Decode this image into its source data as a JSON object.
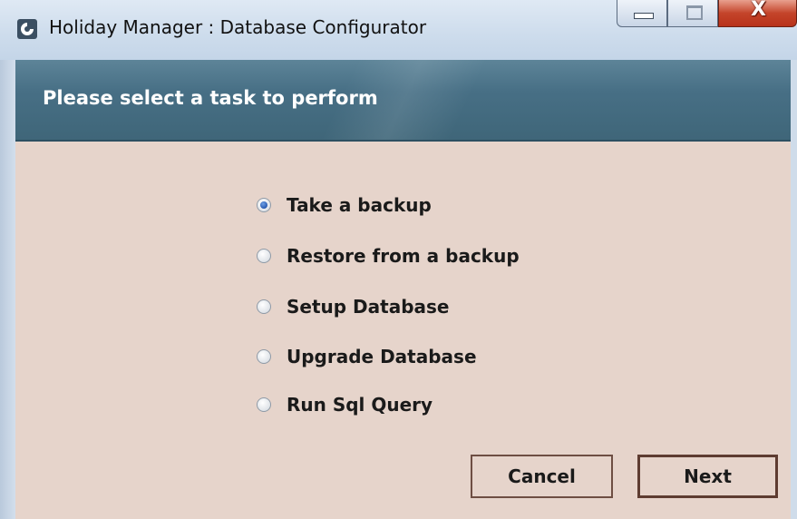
{
  "window": {
    "title": "Holiday Manager : Database Configurator",
    "icon": "app-logo-icon",
    "controls": {
      "minimize_icon": "minimize-icon",
      "maximize_icon": "maximize-icon",
      "close_glyph": "X"
    }
  },
  "banner": {
    "title": "Please select a task to perform",
    "color": "#476f85"
  },
  "options": [
    {
      "label": "Take a backup",
      "selected": true
    },
    {
      "label": "Restore from a backup",
      "selected": false
    },
    {
      "label": "Setup Database",
      "selected": false
    },
    {
      "label": "Upgrade Database",
      "selected": false
    },
    {
      "label": "Run Sql Query",
      "selected": false
    }
  ],
  "buttons": {
    "cancel_label": "Cancel",
    "next_label": "Next"
  },
  "colors": {
    "content_background": "#e6d4cb",
    "button_border": "#6e4e43",
    "close_button": "#c4442a"
  }
}
